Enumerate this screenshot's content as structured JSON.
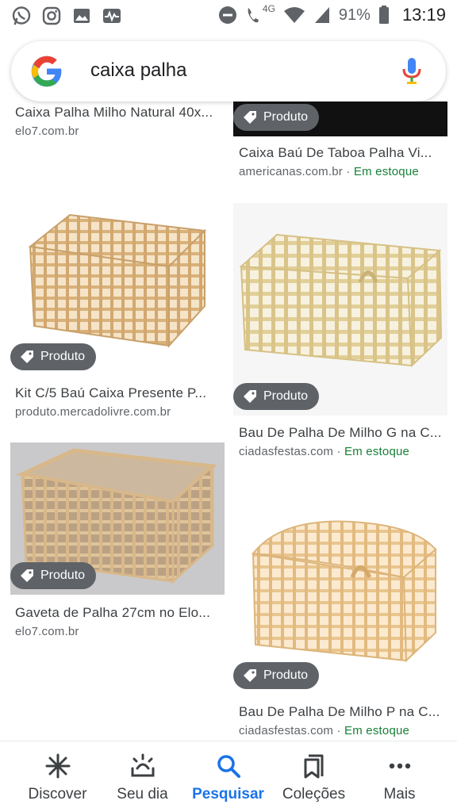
{
  "status_bar": {
    "battery": "91%",
    "time": "13:19",
    "network": "4G",
    "icons_left": [
      "whatsapp-icon",
      "instagram-icon",
      "gallery-icon",
      "activity-icon"
    ],
    "icons_right": [
      "dnd-icon",
      "wifi-call-icon",
      "wifi-icon",
      "signal-icon",
      "battery-icon"
    ]
  },
  "search": {
    "query": "caixa palha"
  },
  "results": {
    "badge_label": "Produto",
    "left": [
      {
        "title": "Caixa Palha Milho Natural 40x...",
        "source": "elo7.com.br"
      },
      {
        "title": "Kit C/5 Baú Caixa Presente P...",
        "source": "produto.mercadolivre.com.br"
      },
      {
        "title": "Gaveta de Palha 27cm no Elo...",
        "source": "elo7.com.br"
      }
    ],
    "right": [
      {
        "title": "Caixa Baú De Taboa Palha Vi...",
        "source": "americanas.com.br",
        "stock": "Em estoque"
      },
      {
        "title": "Bau De Palha De Milho G na C...",
        "source": "ciadasfestas.com",
        "stock": "Em estoque"
      },
      {
        "title": "Bau De Palha De Milho P na C...",
        "source": "ciadasfestas.com",
        "stock": "Em estoque"
      }
    ],
    "separator": " · "
  },
  "bottom_nav": {
    "items": [
      {
        "label": "Discover",
        "icon": "asterisk-icon"
      },
      {
        "label": "Seu dia",
        "icon": "sunrise-icon"
      },
      {
        "label": "Pesquisar",
        "icon": "search-icon"
      },
      {
        "label": "Coleções",
        "icon": "bookmarks-icon"
      },
      {
        "label": "Mais",
        "icon": "more-dots-icon"
      }
    ],
    "active_index": 2,
    "active_color": "#1a73e8"
  }
}
